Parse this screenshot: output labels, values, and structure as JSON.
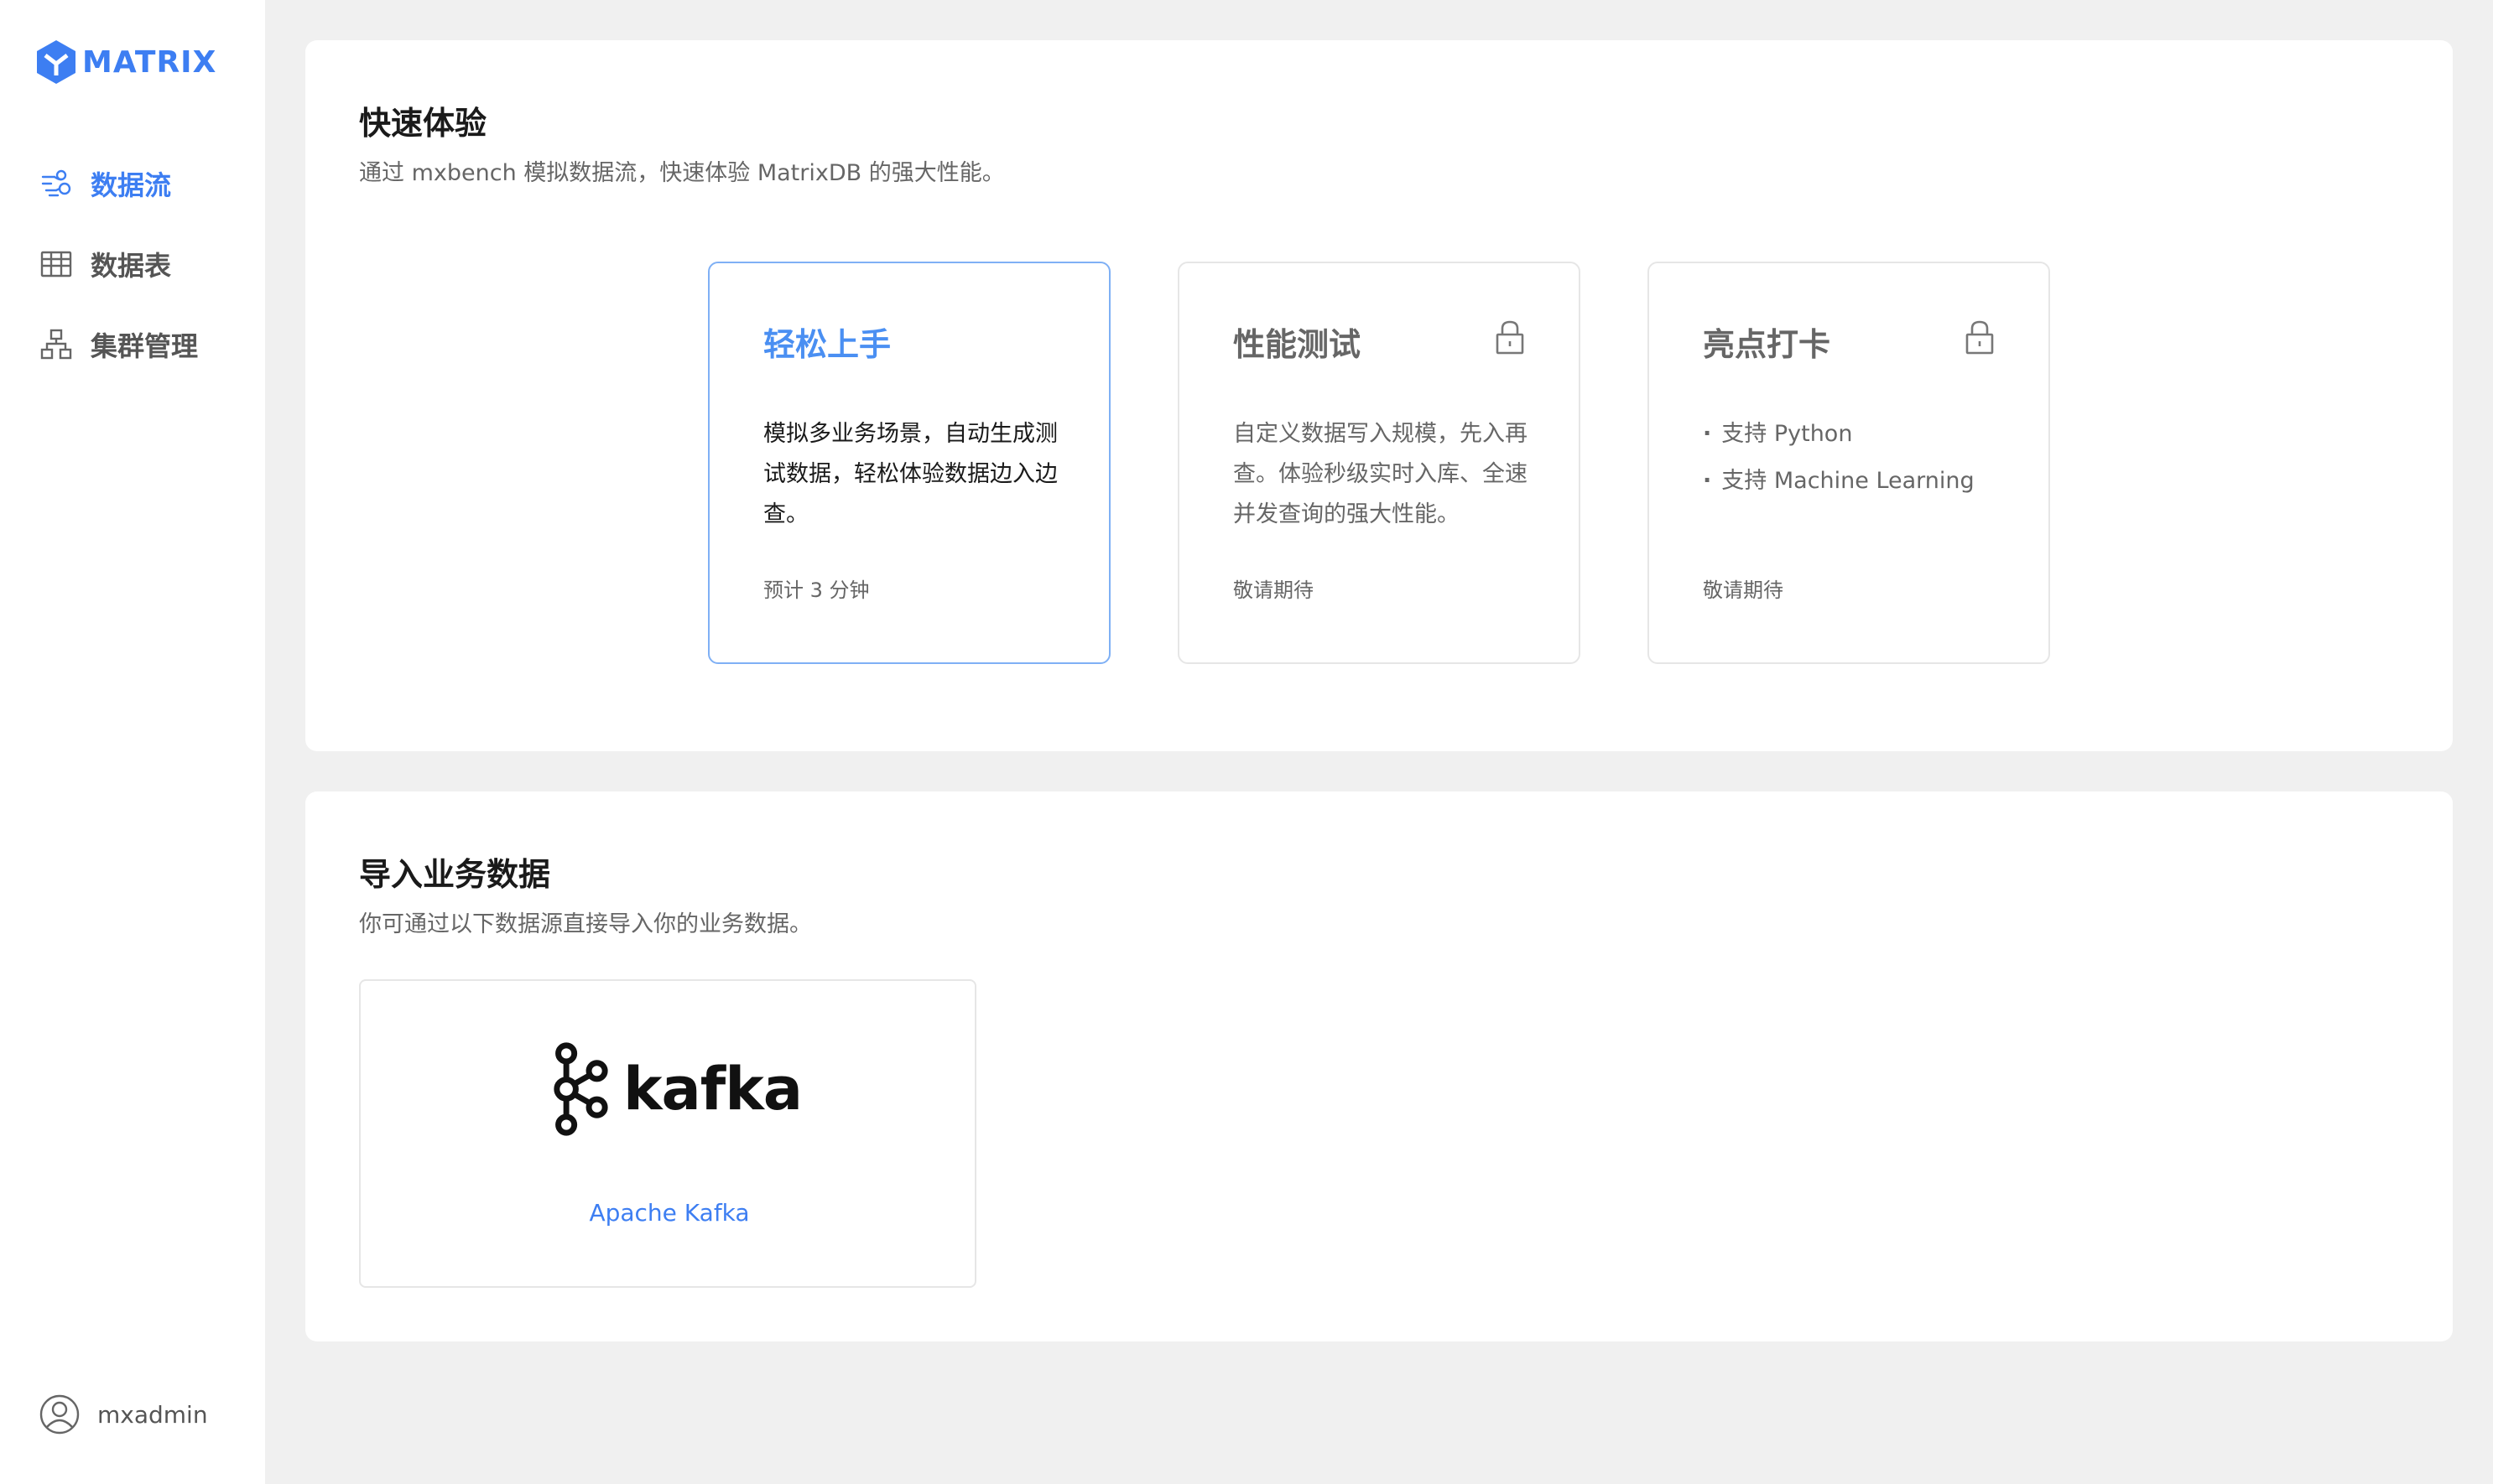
{
  "brand": {
    "name": "MATRIX",
    "accent": "#3d7ef2"
  },
  "sidebar": {
    "items": [
      {
        "label": "数据流",
        "icon": "data-flow-icon",
        "active": true
      },
      {
        "label": "数据表",
        "icon": "table-icon",
        "active": false
      },
      {
        "label": "集群管理",
        "icon": "cluster-icon",
        "active": false
      }
    ],
    "user": {
      "name": "mxadmin",
      "icon": "user-avatar-icon"
    }
  },
  "quick": {
    "title": "快速体验",
    "subtitle": "通过 mxbench 模拟数据流，快速体验 MatrixDB 的强大性能。",
    "cards": [
      {
        "title": "轻松上手",
        "desc": "模拟多业务场景，自动生成测试数据，轻松体验数据边入边查。",
        "foot": "预计 3 分钟",
        "locked": false
      },
      {
        "title": "性能测试",
        "desc": "自定义数据写入规模，先入再查。体验秒级实时入库、全速并发查询的强大性能。",
        "foot": "敬请期待",
        "locked": true
      },
      {
        "title": "亮点打卡",
        "bullets": [
          "支持 Python",
          "支持 Machine Learning"
        ],
        "foot": "敬请期待",
        "locked": true
      }
    ]
  },
  "import": {
    "title": "导入业务数据",
    "subtitle": "你可通过以下数据源直接导入你的业务数据。",
    "sources": [
      {
        "logo_text": "kafka",
        "label": "Apache Kafka",
        "icon": "kafka-logo-icon"
      }
    ]
  }
}
